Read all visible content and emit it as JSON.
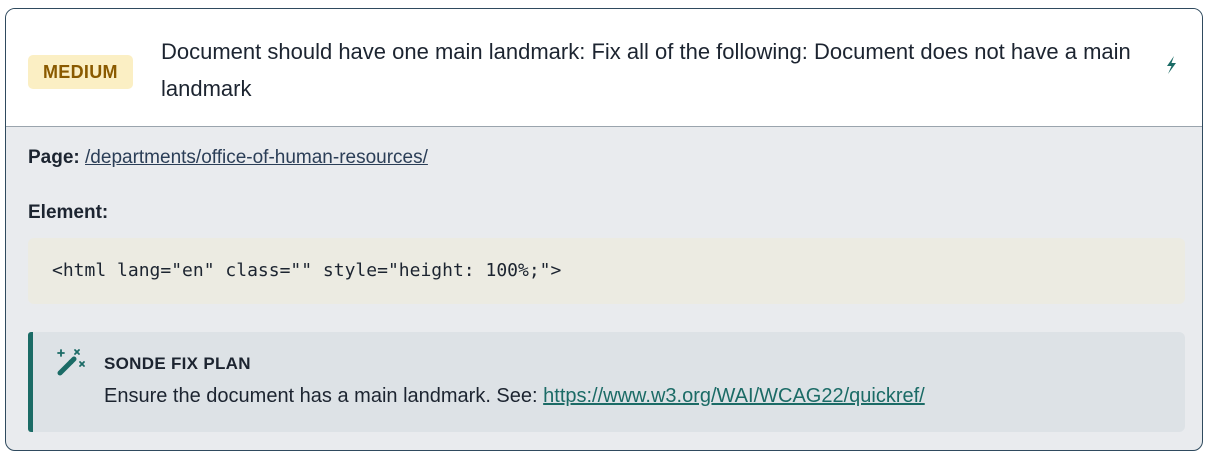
{
  "issue": {
    "severity": "MEDIUM",
    "title": "Document should have one main landmark: Fix all of the following: Document does not have a main landmark"
  },
  "details": {
    "page_label": "Page:",
    "page_path": "/departments/office-of-human-resources/",
    "element_label": "Element:",
    "element_code": "<html lang=\"en\" class=\"\" style=\"height: 100%;\">"
  },
  "fix_plan": {
    "heading": "SONDE FIX PLAN",
    "text": "Ensure the document has a main landmark. See: ",
    "link": "https://www.w3.org/WAI/WCAG22/quickref/"
  },
  "icons": {
    "action": "lightning-bolt-icon",
    "fix_plan": "magic-wand-icon"
  },
  "colors": {
    "severity_bg": "#fbefc4",
    "severity_text": "#8a5a00",
    "accent": "#1b6b66",
    "border": "#2f4a5e"
  }
}
